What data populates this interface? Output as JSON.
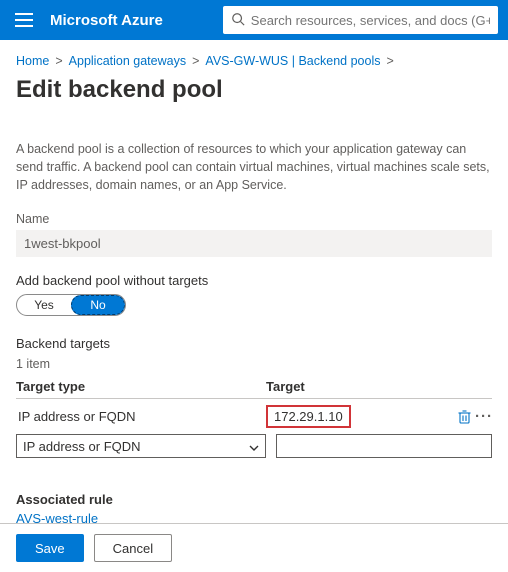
{
  "topbar": {
    "brand": "Microsoft Azure",
    "search_placeholder": "Search resources, services, and docs (G+/)"
  },
  "breadcrumb": {
    "items": [
      "Home",
      "Application gateways",
      "AVS-GW-WUS | Backend pools"
    ]
  },
  "page": {
    "title": "Edit backend pool",
    "description": "A backend pool is a collection of resources to which your application gateway can send traffic. A backend pool can contain virtual machines, virtual machines scale sets, IP addresses, domain names, or an App Service."
  },
  "name": {
    "label": "Name",
    "value": "1west-bkpool"
  },
  "without_targets": {
    "label": "Add backend pool without targets",
    "yes": "Yes",
    "no": "No"
  },
  "targets": {
    "heading": "Backend targets",
    "count": "1 item",
    "columns": {
      "type": "Target type",
      "target": "Target"
    },
    "rows": [
      {
        "type": "IP address or FQDN",
        "target": "172.29.1.10"
      }
    ],
    "new_row": {
      "type": "IP address or FQDN",
      "target": ""
    }
  },
  "associated": {
    "heading": "Associated rule",
    "link": "AVS-west-rule"
  },
  "footer": {
    "save": "Save",
    "cancel": "Cancel"
  }
}
